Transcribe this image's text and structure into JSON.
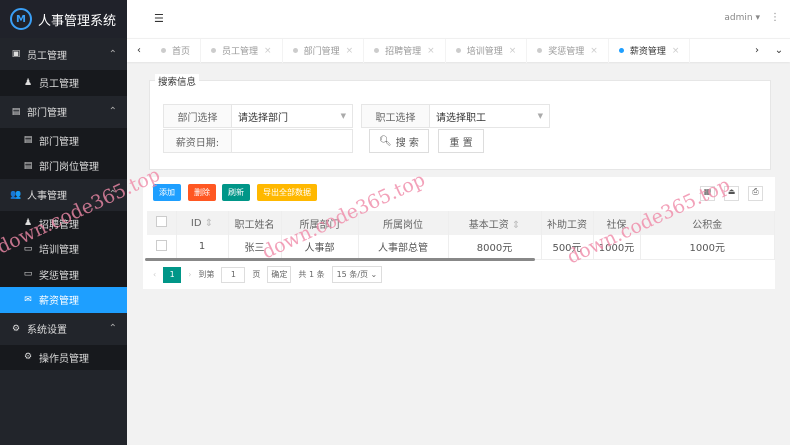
{
  "app": {
    "title": "人事管理系统"
  },
  "header": {
    "user": "admin"
  },
  "sidebar": [
    {
      "label": "员工管理",
      "icon": "id-card-icon",
      "items": [
        {
          "label": "员工管理",
          "icon": "person-icon"
        }
      ]
    },
    {
      "label": "部门管理",
      "icon": "vcard-icon",
      "items": [
        {
          "label": "部门管理",
          "icon": "vcard-icon"
        },
        {
          "label": "部门岗位管理",
          "icon": "vcard-icon"
        }
      ]
    },
    {
      "label": "人事管理",
      "icon": "users-icon",
      "items": [
        {
          "label": "招聘管理",
          "icon": "user-plus-icon"
        },
        {
          "label": "培训管理",
          "icon": "easel-icon"
        },
        {
          "label": "奖惩管理",
          "icon": "monitor-icon"
        },
        {
          "label": "薪资管理",
          "icon": "envelope-icon"
        }
      ]
    },
    {
      "label": "系统设置",
      "icon": "gears-icon",
      "items": [
        {
          "label": "操作员管理",
          "icon": "gears-icon"
        }
      ]
    }
  ],
  "tabs": [
    "首页",
    "员工管理",
    "部门管理",
    "招聘管理",
    "培训管理",
    "奖惩管理",
    "薪资管理"
  ],
  "search": {
    "legend": "搜索信息",
    "dept_label": "部门选择",
    "dept_value": "请选择部门",
    "emp_label": "职工选择",
    "emp_value": "请选择职工",
    "date_label": "薪资日期:",
    "date_value": "",
    "search_btn": "搜 索",
    "reset_btn": "重 置"
  },
  "toolbar": {
    "add": "添加",
    "delete": "删除",
    "refresh": "刷新",
    "export": "导出全部数据"
  },
  "table": {
    "headers": [
      "ID",
      "职工姓名",
      "所属部门",
      "所属岗位",
      "基本工资",
      "补助工资",
      "社保",
      "公积金"
    ],
    "rows": [
      [
        "1",
        "张三",
        "人事部",
        "人事部总管",
        "8000元",
        "500元",
        "1000元",
        "1000元"
      ]
    ]
  },
  "pager": {
    "page": "1",
    "goto": "到第",
    "page_input": "1",
    "page_unit": "页",
    "confirm": "确定",
    "total": "共 1 条",
    "size": "15 条/页"
  },
  "watermark": "down.code365.top",
  "colors": {
    "sidebar": "#22252b",
    "accent": "#1e9fff",
    "add": "#1e9fff",
    "delete": "#ff5722",
    "refresh": "#009688",
    "export": "#ffb800"
  }
}
